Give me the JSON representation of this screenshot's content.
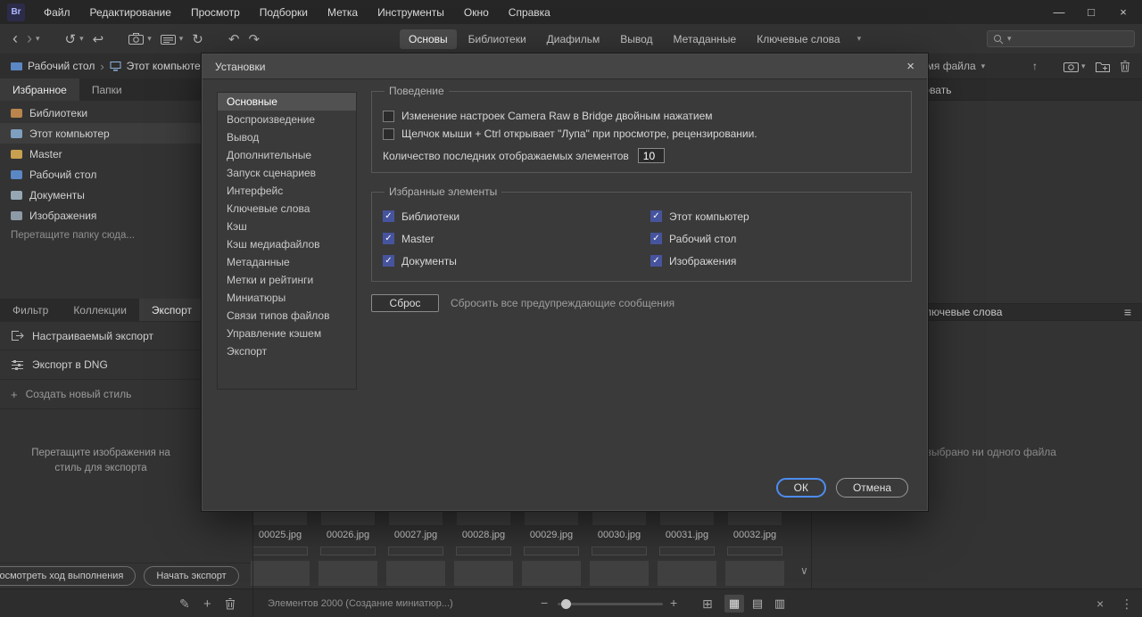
{
  "colors": {
    "accent": "#4e8cf0",
    "checkbox_checked": "#46549e"
  },
  "icons": {
    "back": "‹",
    "forward": "›",
    "chevron_down": "▾",
    "recent": "↺",
    "boomerang": "↩",
    "rotate": "↻",
    "undo": "↶",
    "redo": "↷",
    "minimize": "—",
    "maximize": "□",
    "close": "×",
    "crumb_sep": "›",
    "up": "↑",
    "pencil": "✎",
    "plus": "+",
    "hamburger": "≡",
    "scroll_down": "∨",
    "minus": "−",
    "grid": "⊞",
    "view_thumbs": "▦",
    "view_details": "▤",
    "view_list": "▥",
    "clear": "×",
    "more": "⋮"
  },
  "menubar": {
    "logo": "Br",
    "items": [
      "Файл",
      "Редактирование",
      "Просмотр",
      "Подборки",
      "Метка",
      "Инструменты",
      "Окно",
      "Справка"
    ]
  },
  "toolbar": {
    "workspace_tabs": [
      "Основы",
      "Библиотеки",
      "Диафильм",
      "Вывод",
      "Метаданные",
      "Ключевые слова"
    ],
    "active_workspace": "Основы"
  },
  "pathbar": {
    "crumbs": [
      "Рабочий стол",
      "Этот компьютер"
    ],
    "sort_by": "Имя файла"
  },
  "sidebar": {
    "tabs": [
      "Избранное",
      "Папки"
    ],
    "active_tab": "Избранное",
    "favorites": [
      "Библиотеки",
      "Этот компьютер",
      "Master",
      "Рабочий стол",
      "Документы",
      "Изображения"
    ],
    "drop_hint": "Перетащите папку сюда...",
    "lower_tabs": [
      "Фильтр",
      "Коллекции",
      "Экспорт"
    ],
    "active_lower_tab": "Экспорт",
    "export_items": [
      "Настраиваемый экспорт",
      "Экспорт в DNG",
      "Создать новый стиль"
    ],
    "export_drop_hint": "Перетащите изображения на стиль для экспорта",
    "progress_button": "Посмотреть ход выполнения",
    "start_export_button": "Начать экспорт"
  },
  "dialog": {
    "title": "Установки",
    "nav": [
      "Основные",
      "Воспроизведение",
      "Вывод",
      "Дополнительные",
      "Запуск сценариев",
      "Интерфейс",
      "Ключевые слова",
      "Кэш",
      "Кэш медиафайлов",
      "Метаданные",
      "Метки и рейтинги",
      "Миниатюры",
      "Связи типов файлов",
      "Управление кэшем",
      "Экспорт"
    ],
    "active_nav": "Основные",
    "behavior": {
      "legend": "Поведение",
      "checkbox1": "Изменение настроек Camera Raw в Bridge двойным нажатием",
      "checkbox2": "Щелчок мыши + Ctrl открывает \"Лупа\" при просмотре, рецензировании.",
      "recent_label": "Количество последних отображаемых элементов",
      "recent_value": "10"
    },
    "favorites": {
      "legend": "Избранные элементы",
      "col1": [
        "Библиотеки",
        "Master",
        "Документы"
      ],
      "col2": [
        "Этот компьютер",
        "Рабочий стол",
        "Изображения"
      ]
    },
    "reset_button": "Сброс",
    "reset_hint": "Сбросить все предупреждающие сообщения",
    "ok": "ОК",
    "cancel": "Отмена"
  },
  "content": {
    "filenames": [
      "00025.jpg",
      "00026.jpg",
      "00027.jpg",
      "00028.jpg",
      "00029.jpg",
      "00030.jpg",
      "00031.jpg",
      "00032.jpg"
    ]
  },
  "right_panel": {
    "publish_tab": "Опубликовать",
    "keywords_tab": "Ключевые слова",
    "empty_text": "Не выбрано ни одного файла"
  },
  "statusbar": {
    "items_text": "Элементов 2000 (Создание миниатюр...)"
  }
}
